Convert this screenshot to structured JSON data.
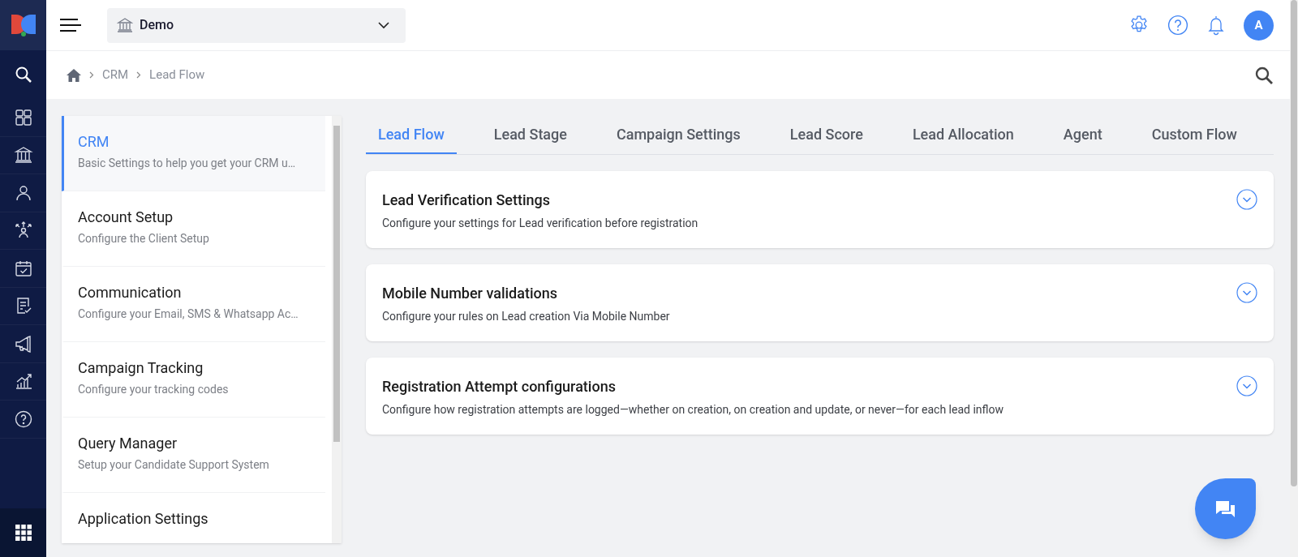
{
  "header": {
    "org_selector": {
      "value": "Demo"
    },
    "avatar": "A"
  },
  "breadcrumb": [
    "CRM",
    "Lead Flow"
  ],
  "nav_rail": [
    {
      "kind": "search"
    },
    {
      "kind": "dashboard"
    },
    {
      "kind": "institution"
    },
    {
      "kind": "person"
    },
    {
      "kind": "distribute"
    },
    {
      "kind": "calendar"
    },
    {
      "kind": "checklist"
    },
    {
      "kind": "megaphone"
    },
    {
      "kind": "chart"
    },
    {
      "kind": "help"
    },
    {
      "kind": "apps"
    }
  ],
  "settings_menu": [
    {
      "title": "CRM",
      "subtitle": "Basic Settings to help you get your CRM u…",
      "selected": true
    },
    {
      "title": "Account Setup",
      "subtitle": "Configure the Client Setup",
      "selected": false
    },
    {
      "title": "Communication",
      "subtitle": "Configure your Email, SMS & Whatsapp Ac…",
      "selected": false
    },
    {
      "title": "Campaign Tracking",
      "subtitle": "Configure your tracking codes",
      "selected": false
    },
    {
      "title": "Query Manager",
      "subtitle": "Setup your Candidate Support System",
      "selected": false
    },
    {
      "title": "Application Settings",
      "selected": false
    }
  ],
  "tabs": [
    {
      "label": "Lead Flow",
      "selected": true
    },
    {
      "label": "Lead Stage",
      "selected": false
    },
    {
      "label": "Campaign Settings",
      "selected": false
    },
    {
      "label": "Lead Score",
      "selected": false
    },
    {
      "label": "Lead Allocation",
      "selected": false
    },
    {
      "label": "Agent",
      "selected": false
    },
    {
      "label": "Custom Flow",
      "selected": false
    }
  ],
  "sections": [
    {
      "title": "Lead Verification Settings",
      "description": "Configure your settings for Lead verification before registration",
      "expanded": false
    },
    {
      "title": "Mobile Number validations",
      "description": "Configure your rules on Lead creation Via Mobile Number",
      "expanded": false
    },
    {
      "title": "Registration Attempt configurations",
      "description": "Configure how registration attempts are logged—whether on creation, on creation and update, or never—for each lead inflow",
      "expanded": false
    }
  ]
}
